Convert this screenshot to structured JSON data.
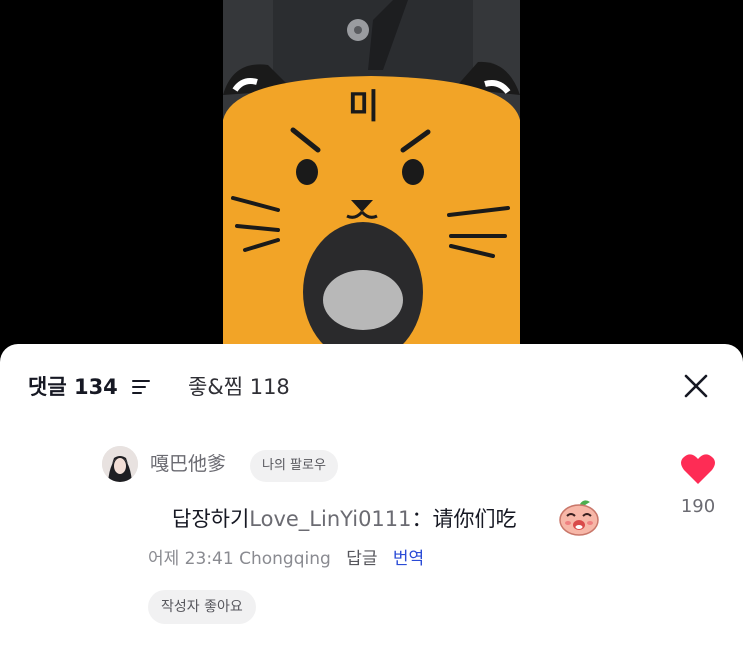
{
  "video": {
    "plush_face_text": "미"
  },
  "tabs": {
    "comments_label": "댓글",
    "comments_count": "134",
    "likes_label": "좋&찜",
    "likes_count": "118"
  },
  "comment": {
    "username": "嘎巴他爹",
    "follow_badge": "나의 팔로우",
    "reply_prefix": "답장하기",
    "mention": "Love_LinYi0111",
    "separator": "：",
    "message": "请你们吃",
    "emoji_icon": "peach-face-emoji",
    "time": "어제 23:41",
    "location": "Chongqing",
    "reply_label": "답글",
    "translate_label": "번역",
    "like_count": "190",
    "author_liked_label": "작성자 좋아요"
  },
  "colors": {
    "heart": "#fe2c55",
    "link": "#2a4bd6",
    "plush": "#f2a427"
  }
}
